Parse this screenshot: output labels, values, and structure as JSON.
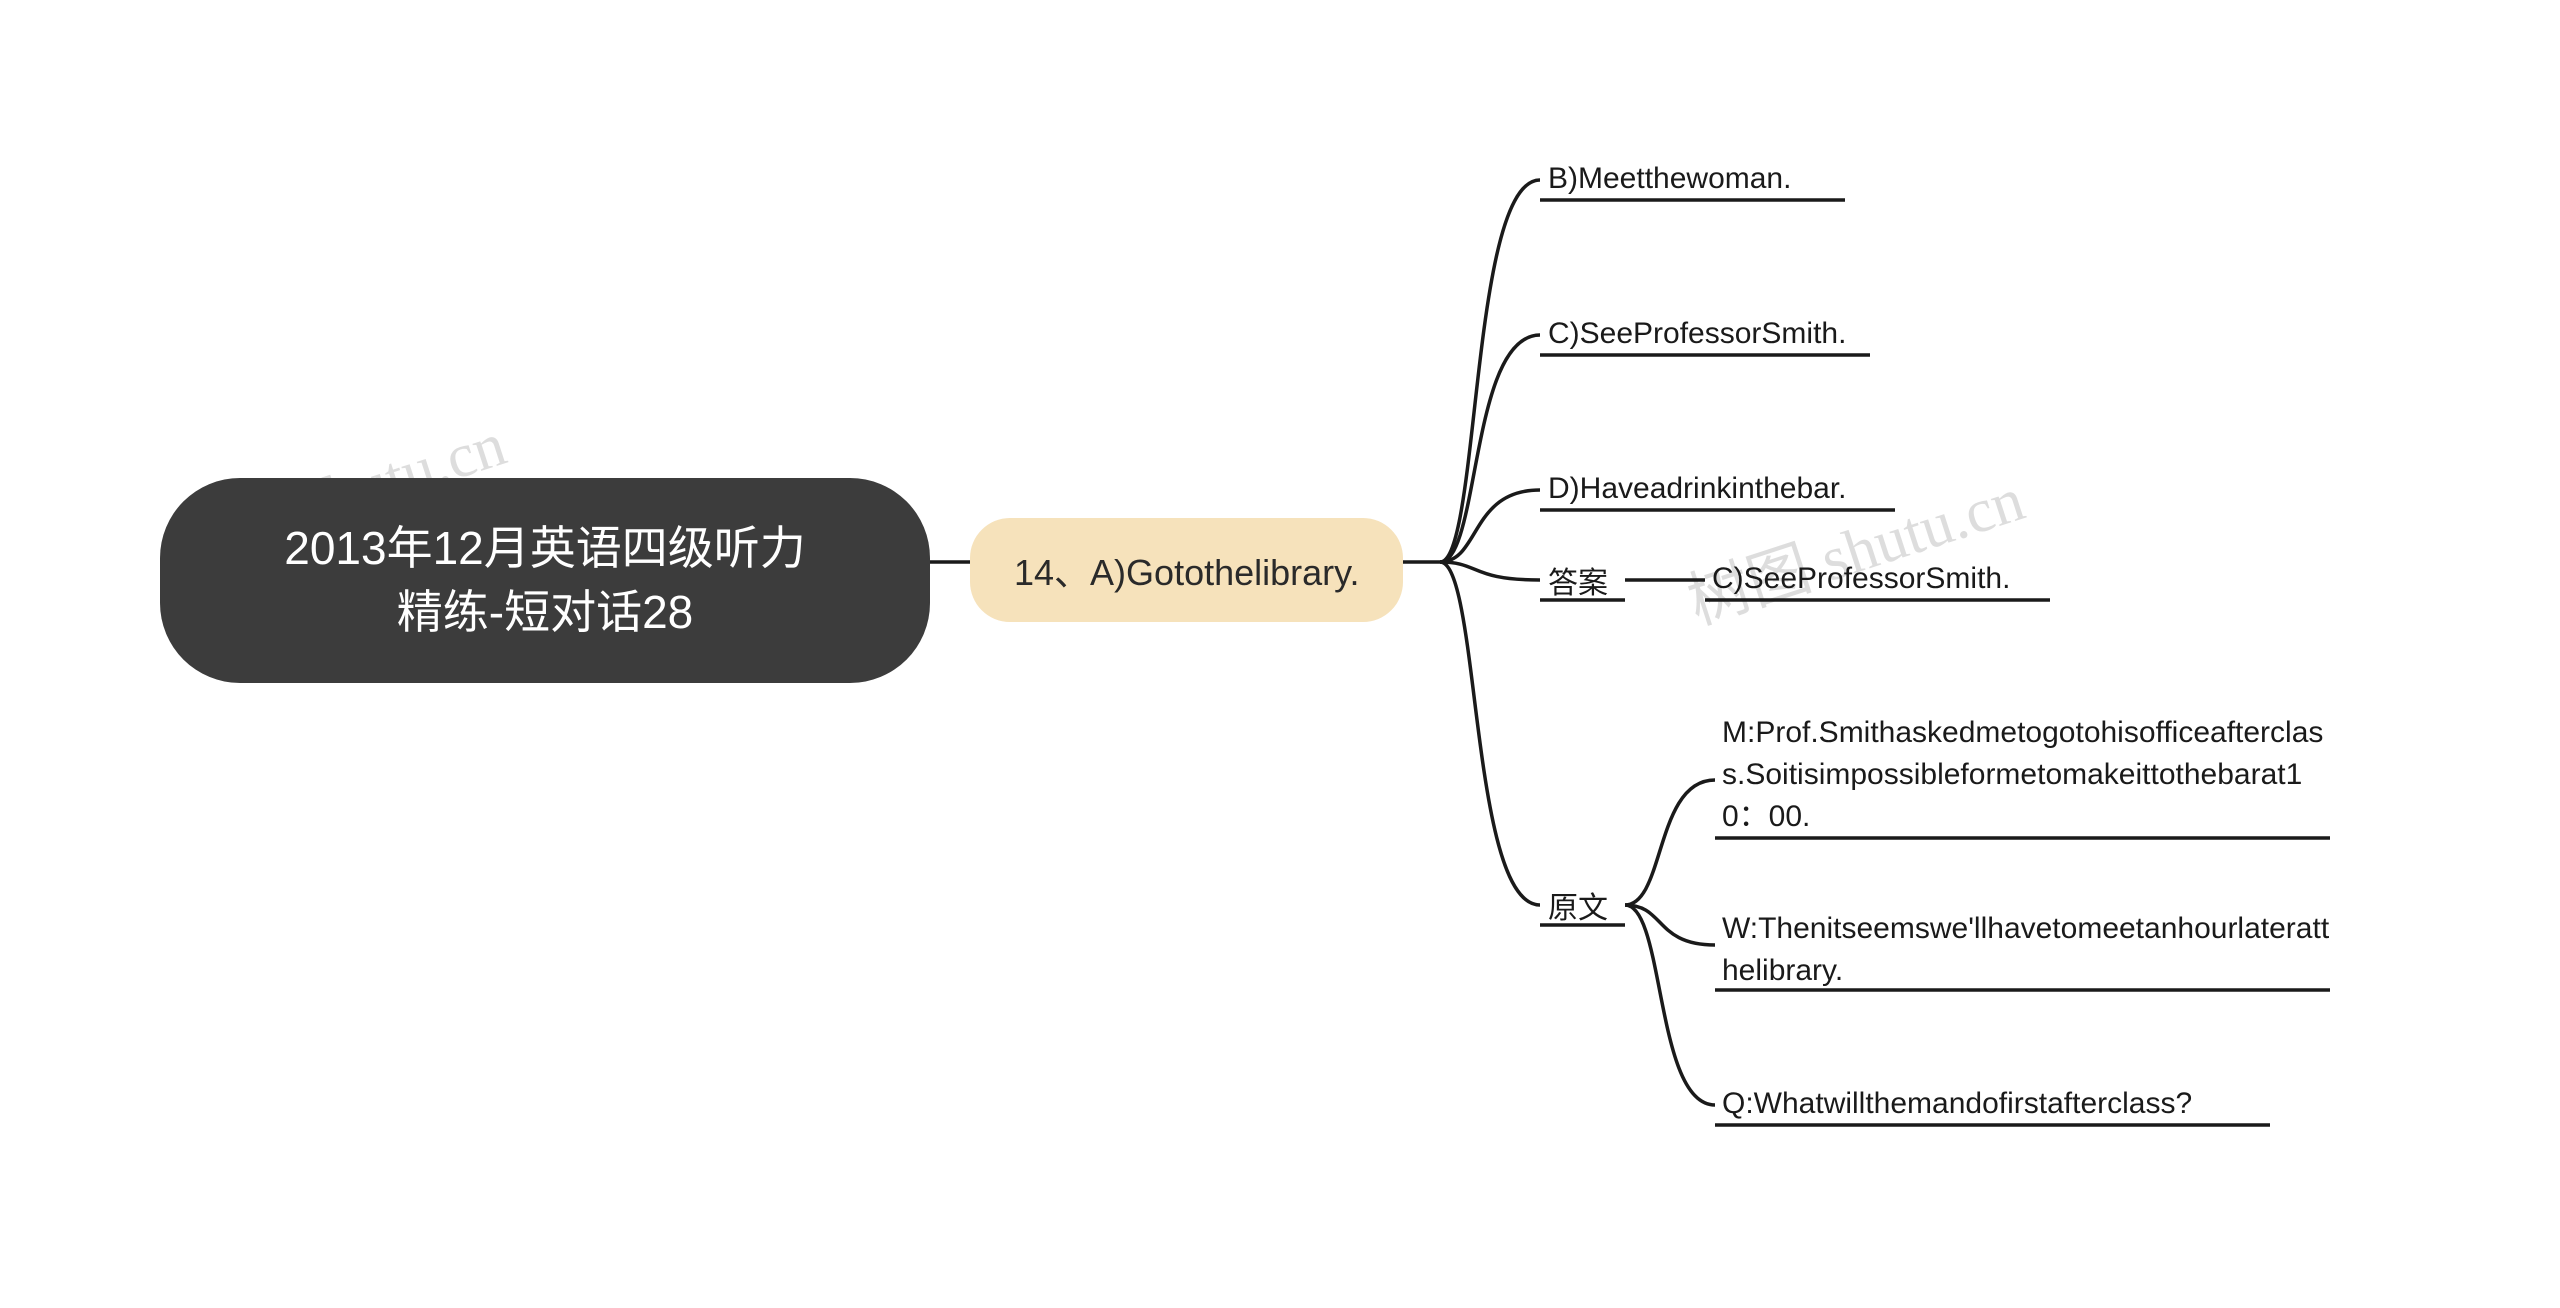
{
  "watermarks": {
    "left": "shutu.cn",
    "right": "树图 shutu.cn"
  },
  "root": {
    "line1": "2013年12月英语四级听力",
    "line2": "精练-短对话28"
  },
  "secondary": {
    "label": "14、A)Gotothelibrary."
  },
  "branches": {
    "option_b": "B)Meetthewoman.",
    "option_c": "C)SeeProfessorSmith.",
    "option_d": "D)Haveadrinkinthebar.",
    "answer_label": "答案",
    "answer_value": "C)SeeProfessorSmith.",
    "source_label": "原文",
    "source_items": {
      "m": "M:Prof.Smithaskedmetogotohisofficeafterclass.Soitisimpossibleformetomakeittothebarat10：00.",
      "w": "W:Thenitseemswe'llhavetomeetanhourlateratthelibrary.",
      "q": "Q:Whatwillthemandofirstafterclass?"
    }
  }
}
